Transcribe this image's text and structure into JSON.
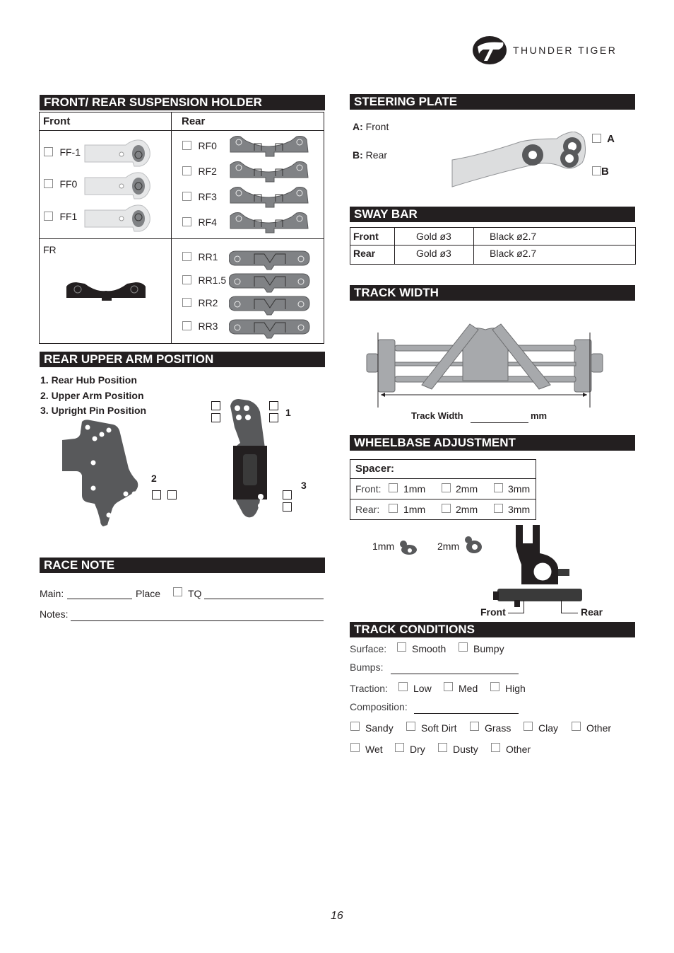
{
  "brand": {
    "name": "THUNDER TIGER",
    "logo_icon": "thunder-tiger-logo"
  },
  "page_number": "16",
  "suspension_holder": {
    "title": "FRONT/ REAR SUSPENSION HOLDER",
    "front_header": "Front",
    "rear_header": "Rear",
    "front_options": [
      "FF-1",
      "FF0",
      "FF1"
    ],
    "rear_front_options": [
      "RF0",
      "RF2",
      "RF3",
      "RF4"
    ],
    "fr_label": "FR",
    "rear_rear_options": [
      "RR1",
      "RR1.5",
      "RR2",
      "RR3"
    ]
  },
  "rear_upper_arm": {
    "title": "REAR UPPER ARM POSITION",
    "items": [
      "1. Rear Hub Position",
      "2. Upper Arm Position",
      "3. Upright Pin Position"
    ],
    "marker_1": "1",
    "marker_2": "2",
    "marker_3": "3"
  },
  "race_note": {
    "title": "RACE NOTE",
    "main_label": "Main:",
    "place_label": "Place",
    "tq_label": "TQ",
    "notes_label": "Notes:"
  },
  "steering_plate": {
    "title": "STEERING PLATE",
    "a_key": "A:",
    "a_value": "Front",
    "b_key": "B:",
    "b_value": "Rear",
    "option_a": "A",
    "option_b": "B"
  },
  "sway_bar": {
    "title": "SWAY BAR",
    "rows": [
      {
        "label": "Front",
        "gold": "Gold ø3",
        "black": "Black ø2.7"
      },
      {
        "label": "Rear",
        "gold": "Gold ø3",
        "black": "Black ø2.7"
      }
    ]
  },
  "track_width": {
    "title": "TRACK WIDTH",
    "label": "Track Width",
    "unit": "mm"
  },
  "wheelbase": {
    "title": "WHEELBASE ADJUSTMENT",
    "spacer_label": "Spacer:",
    "front_label": "Front:",
    "rear_label": "Rear:",
    "sizes": [
      "1mm",
      "2mm",
      "3mm"
    ],
    "spacer_1": "1mm",
    "spacer_2": "2mm",
    "callout_front": "Front",
    "callout_rear": "Rear"
  },
  "track_conditions": {
    "title": "TRACK CONDITIONS",
    "surface_label": "Surface:",
    "surface_options": [
      "Smooth",
      "Bumpy"
    ],
    "bumps_label": "Bumps:",
    "traction_label": "Traction:",
    "traction_options": [
      "Low",
      "Med",
      "High"
    ],
    "composition_label": "Composition:",
    "composition_options": [
      "Sandy",
      "Soft Dirt",
      "Grass",
      "Clay",
      "Other"
    ],
    "moisture_options": [
      "Wet",
      "Dry",
      "Dusty",
      "Other"
    ]
  }
}
